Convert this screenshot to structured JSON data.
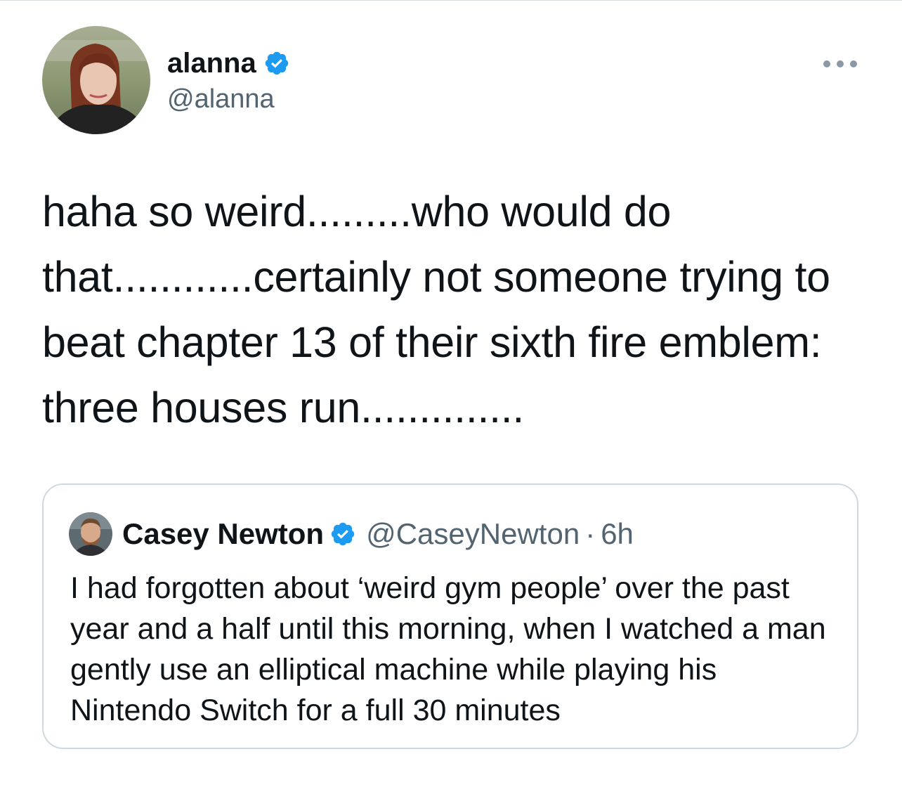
{
  "tweet": {
    "author": {
      "display_name": "alanna",
      "handle": "@alanna",
      "verified": true
    },
    "text": "haha so weird.........who would do that............certainly not someone trying to beat chapter 13 of their sixth fire emblem: three houses run..............",
    "more_icon": "more-horizontal-icon"
  },
  "quoted_tweet": {
    "author": {
      "display_name": "Casey Newton",
      "handle": "@CaseyNewton",
      "verified": true
    },
    "separator": "·",
    "time": "6h",
    "text": "I had forgotten about ‘weird gym people’ over the past year and a half until this morning, when I watched a man gently use an elliptical machine while playing his Nintendo Switch for a full 30 minutes"
  },
  "colors": {
    "text_primary": "#0f1419",
    "text_secondary": "#536471",
    "verified_badge": "#1d9bf0",
    "border": "#cfd9de"
  }
}
